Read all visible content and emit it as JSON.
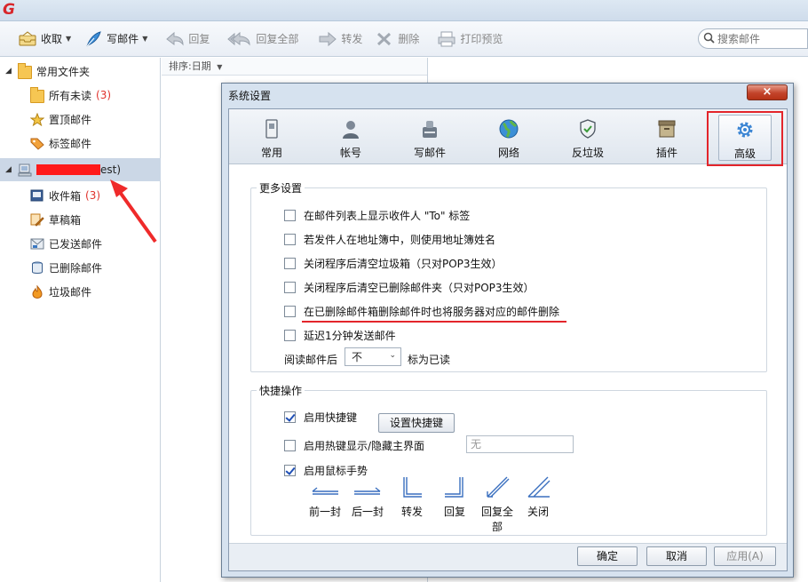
{
  "toolbar": {
    "receive": "收取",
    "compose": "写邮件",
    "reply": "回复",
    "reply_all": "回复全部",
    "forward": "转发",
    "delete": "删除",
    "print_preview": "打印预览",
    "search_placeholder": "搜索邮件"
  },
  "sidebar": {
    "common_folders": "常用文件夹",
    "items": [
      {
        "label": "所有未读",
        "count": "(3)"
      },
      {
        "label": "置顶邮件"
      },
      {
        "label": "标签邮件"
      }
    ],
    "account_label_visible": "est)",
    "account_items": [
      {
        "label": "收件箱",
        "count": "(3)"
      },
      {
        "label": "草稿箱"
      },
      {
        "label": "已发送邮件"
      },
      {
        "label": "已删除邮件"
      },
      {
        "label": "垃圾邮件"
      }
    ]
  },
  "list": {
    "sort_label": "排序:日期"
  },
  "dialog": {
    "title": "系统设置",
    "close": "×",
    "tabs": [
      "常用",
      "帐号",
      "写邮件",
      "网络",
      "反垃圾",
      "插件",
      "高级"
    ],
    "more_settings": {
      "legend": "更多设置",
      "options": [
        "在邮件列表上显示收件人 \"To\" 标签",
        "若发件人在地址簿中，则使用地址簿姓名",
        "关闭程序后清空垃圾箱（只对POP3生效）",
        "关闭程序后清空已删除邮件夹（只对POP3生效）",
        "在已删除邮件箱删除邮件时也将服务器对应的邮件删除",
        "延迟1分钟发送邮件"
      ],
      "read_after_label": "阅读邮件后",
      "read_after_value": "不",
      "mark_read_label": "标为已读"
    },
    "shortcuts": {
      "legend": "快捷操作",
      "enable_shortcuts": "启用快捷键",
      "set_shortcuts_button": "设置快捷键",
      "hotkey_toggle": "启用热键显示/隐藏主界面",
      "hotkey_value": "无",
      "mouse_gesture": "启用鼠标手势",
      "gestures": [
        "前一封",
        "后一封",
        "转发",
        "回复",
        "回复全部",
        "关闭"
      ]
    },
    "buttons": {
      "ok": "确定",
      "cancel": "取消",
      "apply": "应用(A)"
    }
  }
}
